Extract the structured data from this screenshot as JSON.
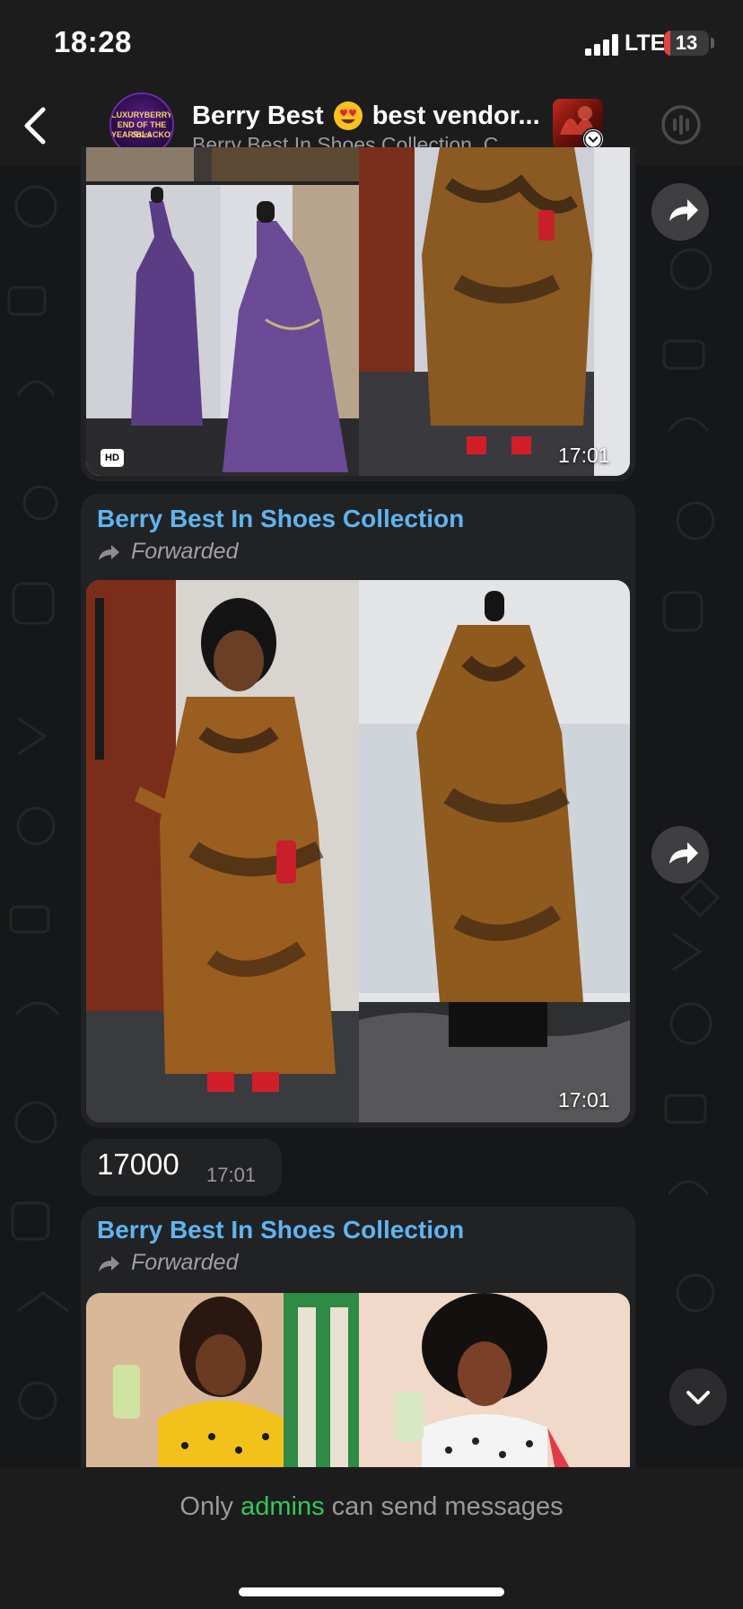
{
  "status_bar": {
    "time": "18:28",
    "network": "LTE",
    "battery_level": "13",
    "battery_fraction": 0.13
  },
  "header": {
    "title": "Berry Best",
    "title_emoji": "heart-eyes-emoji",
    "title_rest": "best vendor...",
    "subtitle": "Berry Best In Shoes Collection, C...",
    "avatar_text": "LUXURYBERRY END OF THE YEAR/BLACKOUT",
    "avatar_sale": "Sales"
  },
  "messages": [
    {
      "type": "album",
      "time": "17:01",
      "hd": "HD"
    },
    {
      "type": "album",
      "sender": "Berry Best In Shoes Collection",
      "forwarded": "Forwarded",
      "time": "17:01"
    },
    {
      "type": "text",
      "text": "17000",
      "time": "17:01"
    },
    {
      "type": "album",
      "sender": "Berry Best In Shoes Collection",
      "forwarded": "Forwarded"
    }
  ],
  "footer": {
    "prefix": "Only",
    "accent": "admins",
    "suffix": "can send messages"
  },
  "colors": {
    "accent_link": "#5fb4f0",
    "admins_green": "#34c759",
    "bubble_bg": "#212224",
    "bar_bg": "#1c1c1d"
  },
  "icons": [
    "back-chevron-icon",
    "signal-icon",
    "battery-icon",
    "voice-chat-icon",
    "share-arrow-icon",
    "forward-arrow-icon",
    "chevron-down-icon"
  ]
}
